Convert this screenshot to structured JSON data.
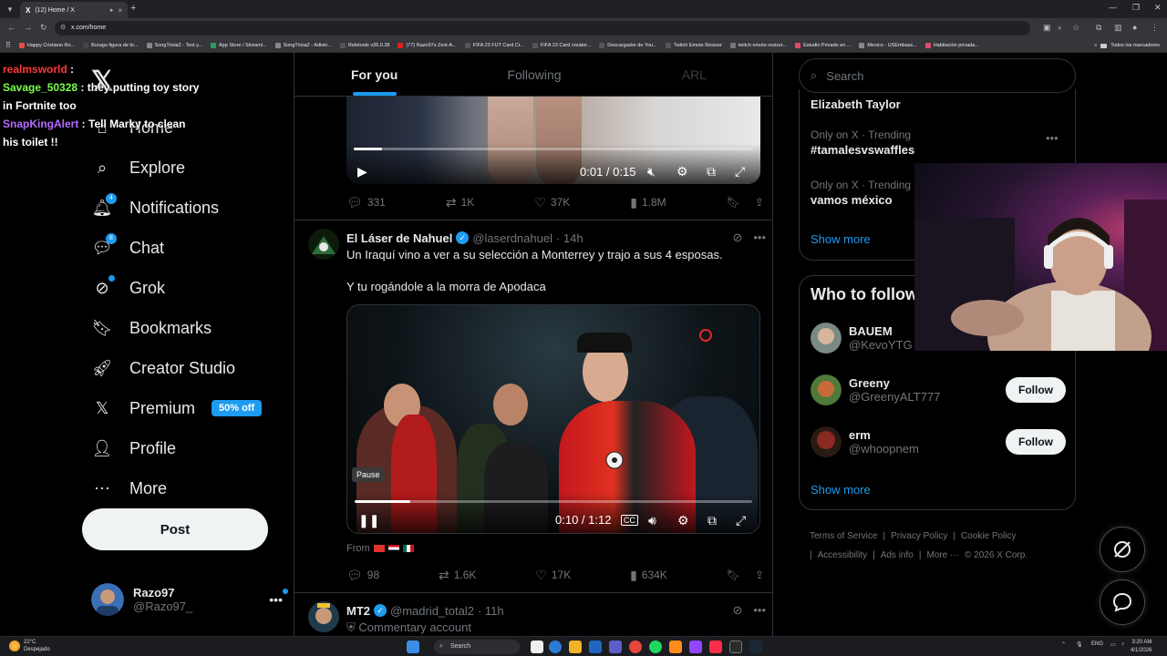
{
  "browser": {
    "tab_title": "(12) Home / X",
    "url": "x.com/home",
    "bookmarks": [
      {
        "label": "Happy Cristiano Ro...",
        "color": "#e84a4a"
      },
      {
        "label": "Burago figura de to...",
        "color": "#444"
      },
      {
        "label": "SongTrivia2 - Test y...",
        "color": "#888"
      },
      {
        "label": "App Store / Streami...",
        "color": "#2a9d5c"
      },
      {
        "label": "SongTrivia2 - Adivin...",
        "color": "#888"
      },
      {
        "label": "Reletools v26.0.28",
        "color": "#555"
      },
      {
        "label": "(77) Razo97s Zest-A...",
        "color": "#e02020"
      },
      {
        "label": "FIFA 23 FUT Card Cr...",
        "color": "#555"
      },
      {
        "label": "FIFA 23 Card creator...",
        "color": "#555"
      },
      {
        "label": "Descargador de You...",
        "color": "#555"
      },
      {
        "label": "Twitch Emote Resizer",
        "color": "#555"
      },
      {
        "label": "twitch emote resizer...",
        "color": "#777"
      },
      {
        "label": "Estudio Privado en ...",
        "color": "#e04a6a"
      },
      {
        "label": "Mexico - USEmbass...",
        "color": "#888"
      },
      {
        "label": "Habitación privada...",
        "color": "#e04a6a"
      }
    ],
    "bookmarks_folder": "Todos los marcadores"
  },
  "chat": [
    {
      "user": "realmsworld",
      "color": "#ff3a3a",
      "text": ""
    },
    {
      "user": "Savage_50328",
      "color": "#7cff4a",
      "text": "they putting toy story in Fortnite too"
    },
    {
      "user": "SnapKingAlert",
      "color": "#b46cff",
      "text": "Tell Marky to clean his toilet !!"
    }
  ],
  "nav": {
    "items": [
      {
        "label": "Home",
        "icon": "home-icon"
      },
      {
        "label": "Explore",
        "icon": "search-icon"
      },
      {
        "label": "Notifications",
        "icon": "bell-icon",
        "badge": "4"
      },
      {
        "label": "Chat",
        "icon": "chat-icon",
        "badge": "8"
      },
      {
        "label": "Grok",
        "icon": "grok-icon"
      },
      {
        "label": "Bookmarks",
        "icon": "bookmark-icon"
      },
      {
        "label": "Creator Studio",
        "icon": "rocket-icon"
      },
      {
        "label": "Premium",
        "icon": "x-logo-icon",
        "pill": "50% off"
      },
      {
        "label": "Profile",
        "icon": "person-icon"
      },
      {
        "label": "More",
        "icon": "more-circle-icon"
      }
    ],
    "post_label": "Post",
    "account": {
      "name": "Razo97",
      "handle": "@Razo97_"
    }
  },
  "feed": {
    "tabs": [
      "For you",
      "Following",
      "ARL"
    ],
    "post1": {
      "time": "0:01 / 0:15",
      "replies": "331",
      "reposts": "1K",
      "likes": "37K",
      "views": "1.8M"
    },
    "post2": {
      "name": "El Láser de Nahuel",
      "handle": "@laserdnahuel",
      "age": "· 14h",
      "text1": "Un Iraquí vino a ver a su selección a Monterrey y trajo a sus 4 esposas.",
      "text2": "Y tu rogándole a la morra de Apodaca",
      "tooltip": "Pause",
      "time": "0:10 / 1:12",
      "cc": "CC",
      "from": "From",
      "replies": "98",
      "reposts": "1.6K",
      "likes": "17K",
      "views": "634K"
    },
    "post3": {
      "name": "MT2",
      "handle": "@madrid_total2",
      "age": "· 11h",
      "sub": "Commentary account"
    }
  },
  "right": {
    "search_placeholder": "Search",
    "trends": [
      {
        "meta": "",
        "title": "Elizabeth Taylor"
      },
      {
        "meta": "Only on X · Trending",
        "title": "#tamalesvswaffles"
      },
      {
        "meta": "Only on X · Trending",
        "title": "vamos méxico"
      }
    ],
    "show_more": "Show more",
    "who_to_follow": "Who to follow",
    "follow": [
      {
        "name": "BAUEM",
        "handle": "@KevoYTG",
        "button": ""
      },
      {
        "name": "Greeny",
        "handle": "@GreenyALT777",
        "button": "Follow"
      },
      {
        "name": "erm",
        "handle": "@whoopnem",
        "button": "Follow"
      }
    ],
    "show_more2": "Show more",
    "footer": [
      "Terms of Service",
      "|",
      "Privacy Policy",
      "|",
      "Cookie Policy",
      "|",
      "Accessibility",
      "|",
      "Ads info",
      "|",
      "More ···",
      "© 2026 X Corp."
    ]
  },
  "taskbar": {
    "temp": "22°C",
    "weather": "Despejado",
    "search": "Search",
    "lang": "ENG",
    "time": "3:20 AM",
    "date": "4/1/2026"
  }
}
